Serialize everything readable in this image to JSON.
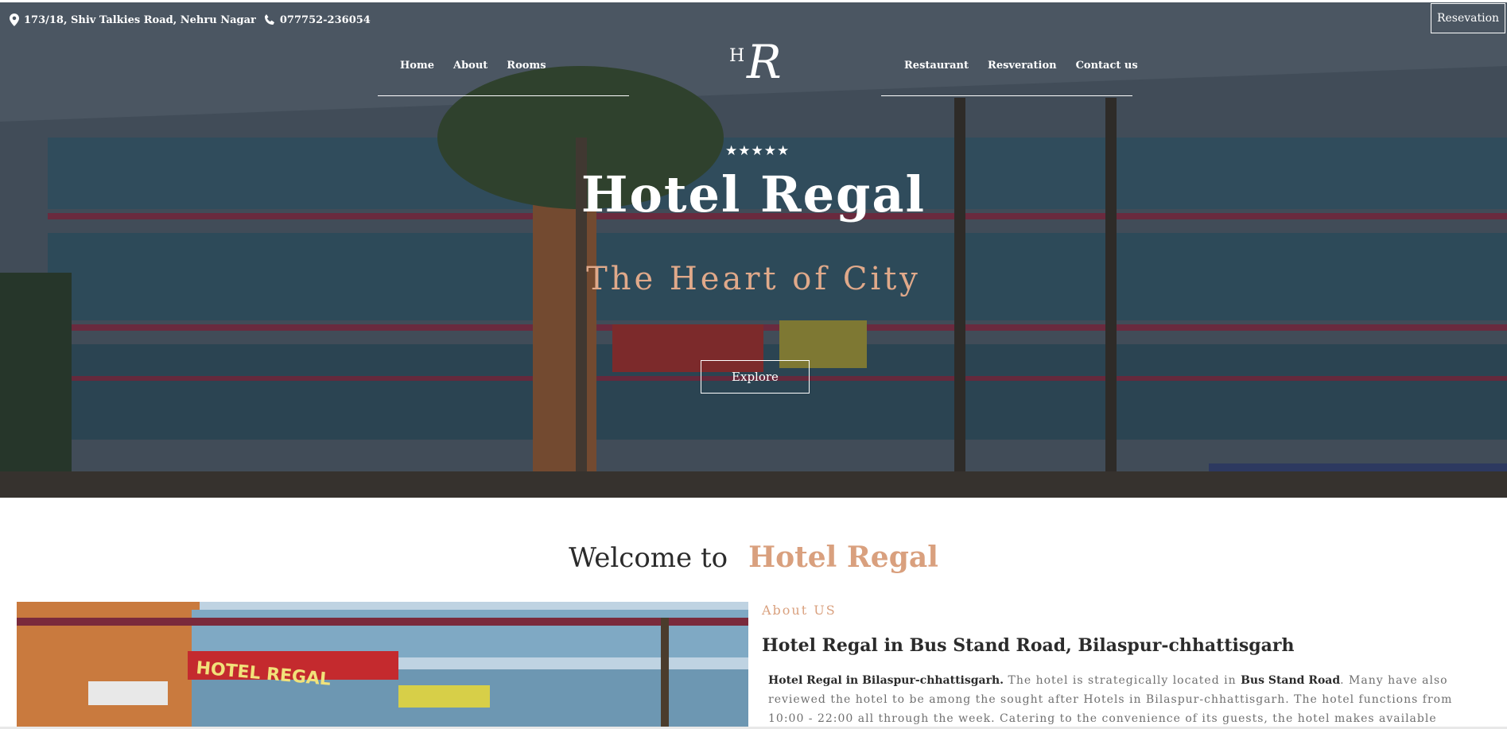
{
  "topbar": {
    "address": "173/18, Shiv Talkies Road, Nehru Nagar",
    "phone": "077752-236054",
    "reserve_button": "Resevation"
  },
  "nav": {
    "left": [
      "Home",
      "About",
      "Rooms"
    ],
    "right": [
      "Restaurant",
      "Resveration",
      "Contact us"
    ]
  },
  "logo": {
    "small": "H",
    "big": "R"
  },
  "hero": {
    "stars": "★★★★★",
    "title": "Hotel Regal",
    "subtitle": "The Heart of City",
    "explore_button": "Explore"
  },
  "welcome": {
    "prefix": "Welcome to",
    "name": "Hotel Regal"
  },
  "about": {
    "label": "About US",
    "heading": "Hotel Regal in Bus Stand Road, Bilaspur-chhattisgarh",
    "text_bold_1": "Hotel Regal in Bilaspur-chhattisgarh.",
    "text_1": " The hotel is strategically located in ",
    "text_bold_2": "Bus Stand Road",
    "text_2": ". Many have also reviewed the hotel to be among the sought after Hotels in Bilaspur-chhattisgarh. The hotel functions from 10:00 - 22:00 all through the week. Catering to the convenience of its guests, the hotel makes available various"
  },
  "colors": {
    "accent": "#d9a07e",
    "dark_text": "#2b2b2b",
    "body_text": "#6f6f6f"
  },
  "icons": {
    "address": "map-pin-icon",
    "phone": "phone-icon"
  }
}
